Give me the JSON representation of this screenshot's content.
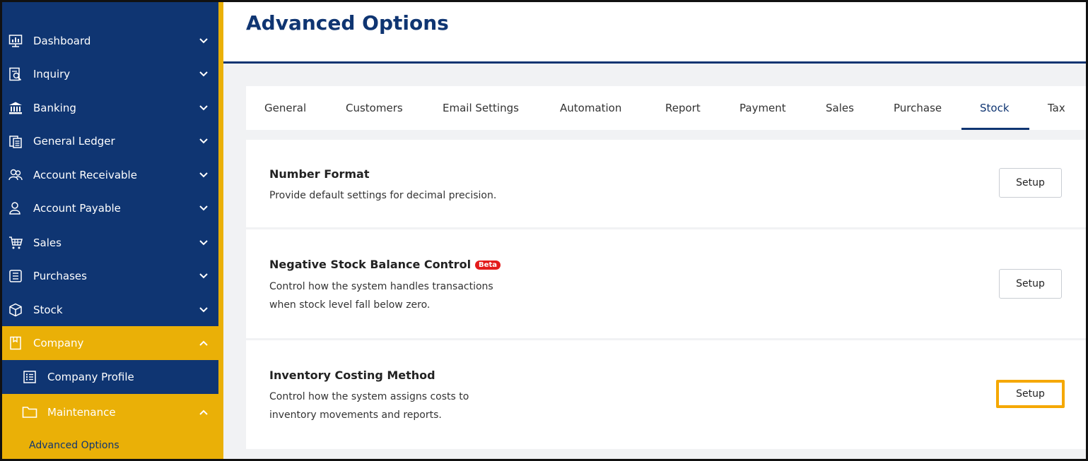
{
  "sidebar": {
    "items": [
      {
        "label": "Dashboard",
        "icon": "dashboard-icon"
      },
      {
        "label": "Inquiry",
        "icon": "inquiry-icon"
      },
      {
        "label": "Banking",
        "icon": "bank-icon"
      },
      {
        "label": "General Ledger",
        "icon": "ledger-icon"
      },
      {
        "label": "Account Receivable",
        "icon": "receivable-icon"
      },
      {
        "label": "Account Payable",
        "icon": "payable-icon"
      },
      {
        "label": "Sales",
        "icon": "cart-icon"
      },
      {
        "label": "Purchases",
        "icon": "purchases-icon"
      },
      {
        "label": "Stock",
        "icon": "box-icon"
      }
    ],
    "company": {
      "label": "Company",
      "icon": "bookmark-icon"
    },
    "company_profile": {
      "label": "Company Profile",
      "icon": "list-icon"
    },
    "maintenance": {
      "label": "Maintenance",
      "icon": "folder-icon"
    },
    "advanced_options": {
      "label": "Advanced Options"
    }
  },
  "header": {
    "title": "Advanced Options"
  },
  "tabs": [
    {
      "label": "General"
    },
    {
      "label": "Customers"
    },
    {
      "label": "Email Settings"
    },
    {
      "label": "Automation"
    },
    {
      "label": "Report"
    },
    {
      "label": "Payment"
    },
    {
      "label": "Sales"
    },
    {
      "label": "Purchase"
    },
    {
      "label": "Stock",
      "active": true
    },
    {
      "label": "Tax"
    }
  ],
  "cards": [
    {
      "title": "Number Format",
      "desc": "Provide default settings for decimal precision.",
      "button": "Setup"
    },
    {
      "title": "Negative Stock Balance Control",
      "badge": "Beta",
      "desc_line1": "Control how the system handles transactions",
      "desc_line2": "when stock level fall below zero.",
      "button": "Setup"
    },
    {
      "title": "Inventory Costing Method",
      "desc_line1": "Control how the system assigns costs to",
      "desc_line2": "inventory movements and reports.",
      "button": "Setup"
    }
  ],
  "colors": {
    "navy": "#0f3572",
    "gold": "#eab007",
    "highlight": "#f5a800",
    "beta": "#e31b1b"
  }
}
